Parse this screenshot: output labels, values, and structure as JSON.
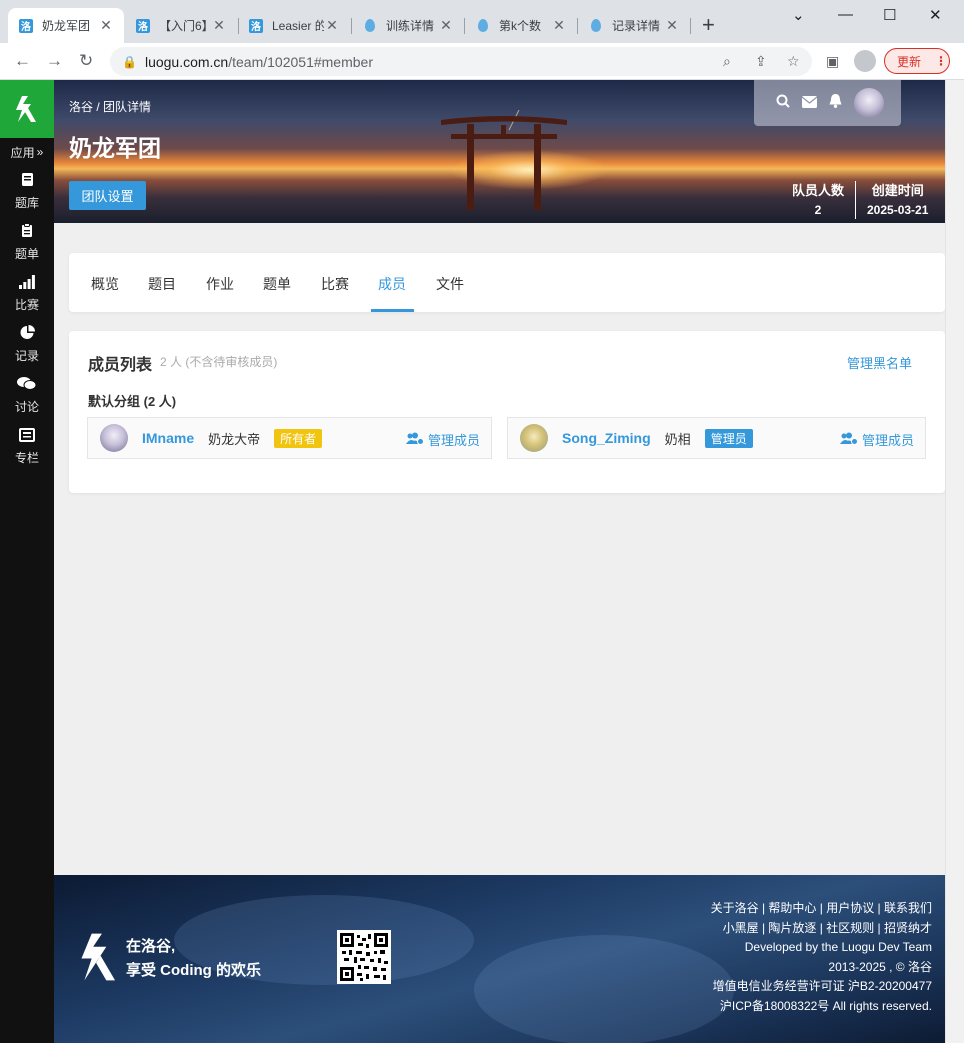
{
  "browser": {
    "tabs": [
      {
        "title": "奶龙军团",
        "icon": "luogu-logo"
      },
      {
        "title": "【入门6】",
        "icon": "luogu-logo"
      },
      {
        "title": "Leasier 的",
        "icon": "luogu-logo"
      },
      {
        "title": "训练详情",
        "icon": "drop"
      },
      {
        "title": "第k个数",
        "icon": "drop"
      },
      {
        "title": "记录详情",
        "icon": "drop"
      }
    ],
    "url_host": "luogu.com.cn",
    "url_path": "/team/102051#member",
    "update_label": "更新"
  },
  "sidebar": {
    "apps_label": "应用",
    "items": [
      {
        "label": "题库",
        "icon": "book-icon"
      },
      {
        "label": "题单",
        "icon": "clipboard-icon"
      },
      {
        "label": "比赛",
        "icon": "bar-chart-icon"
      },
      {
        "label": "记录",
        "icon": "pie-chart-icon"
      },
      {
        "label": "讨论",
        "icon": "comments-icon"
      },
      {
        "label": "专栏",
        "icon": "newspaper-icon"
      }
    ]
  },
  "banner": {
    "breadcrumb": "洛谷 / 团队详情",
    "team_name": "奶龙军团",
    "settings_label": "团队设置",
    "member_count_label": "队员人数",
    "member_count": "2",
    "created_label": "创建时间",
    "created_date": "2025-03-21"
  },
  "tabs": [
    "概览",
    "题目",
    "作业",
    "题单",
    "比赛",
    "成员",
    "文件"
  ],
  "members": {
    "title": "成员列表",
    "subtitle": "2 人 (不含待审核成员)",
    "blacklist_label": "管理黑名单",
    "group_label": "默认分组 (2 人)",
    "list": [
      {
        "username": "IMname",
        "nickname": "奶龙大帝",
        "role": "所有者",
        "role_color": "#f1c40f",
        "manage_label": "管理成员"
      },
      {
        "username": "Song_Ziming",
        "nickname": "奶相",
        "role": "管理员",
        "role_color": "#3498db",
        "manage_label": "管理成员"
      }
    ]
  },
  "footer": {
    "slogan_line1": "在洛谷,",
    "slogan_line2": "享受 Coding 的欢乐",
    "links_line1": "关于洛谷 | 帮助中心 | 用户协议 | 联系我们",
    "links_line2": "小黑屋 | 陶片放逐 | 社区规则 | 招贤纳才",
    "dev_line": "Developed by the Luogu Dev Team",
    "copyright": "2013-2025 , © 洛谷",
    "license": "增值电信业务经营许可证 沪B2-20200477",
    "icp": "沪ICP备18008322号 All rights reserved."
  },
  "colors": {
    "brand_green": "#1fa839",
    "accent_blue": "#3498db"
  }
}
